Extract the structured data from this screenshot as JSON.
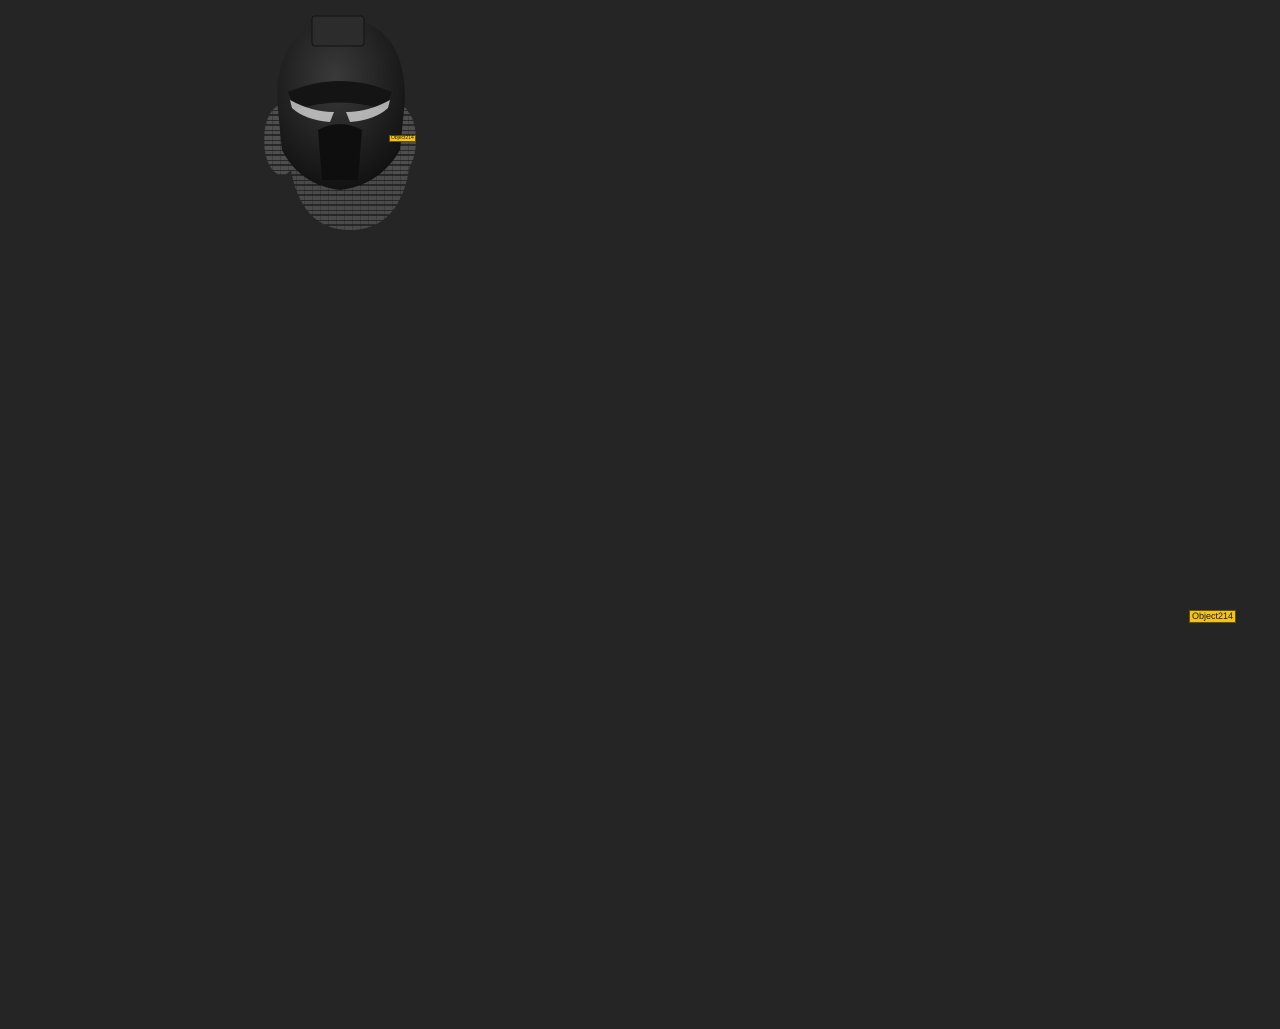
{
  "viewport": {
    "background": "#252525",
    "shaded_fill": "#222222",
    "wire_fill": "#6e6e6e",
    "wire_color": "#141414",
    "label_color": "#f2c318"
  },
  "object_labels": {
    "top_left": "Object214",
    "right_large": "Object214"
  }
}
